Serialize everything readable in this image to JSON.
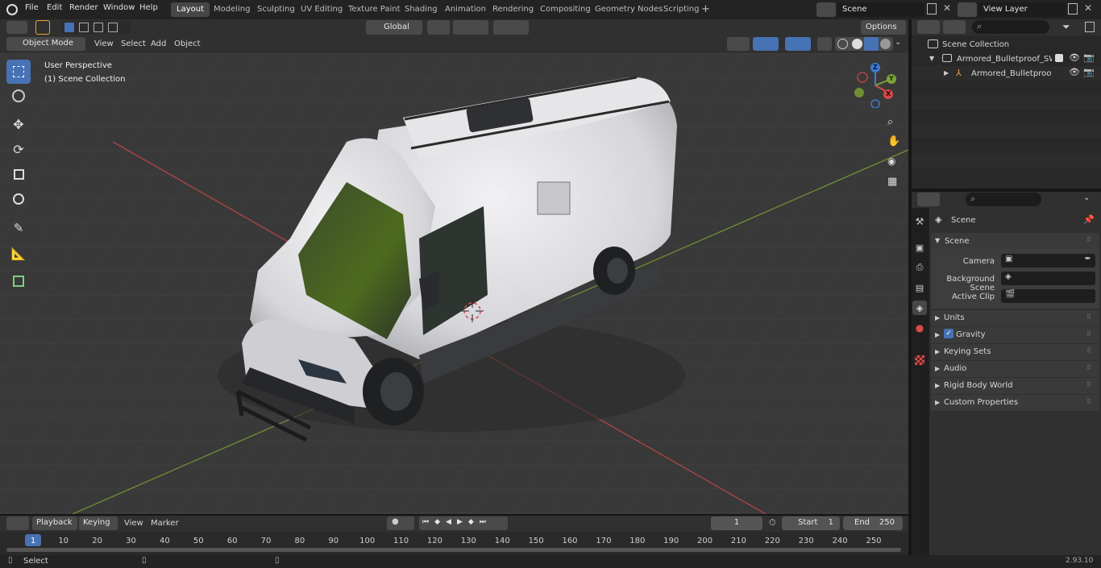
{
  "menu": [
    "File",
    "Edit",
    "Render",
    "Window",
    "Help"
  ],
  "workspaces": [
    "Layout",
    "Modeling",
    "Sculpting",
    "UV Editing",
    "Texture Paint",
    "Shading",
    "Animation",
    "Rendering",
    "Compositing",
    "Geometry Nodes",
    "Scripting"
  ],
  "active_workspace": "Layout",
  "scene_field": "Scene",
  "view_layer_field": "View Layer",
  "viewport_header": {
    "mode": "Object Mode",
    "menus": [
      "View",
      "Select",
      "Add",
      "Object"
    ],
    "transform_orientation": "Global",
    "options": "Options"
  },
  "viewport_overlay": {
    "perspective": "User Perspective",
    "collection": "(1) Scene Collection"
  },
  "gizmo": {
    "x": "X",
    "y": "Y",
    "z": "Z"
  },
  "outliner": {
    "root": "Scene Collection",
    "items": [
      "Armored_Bulletproof_SWAT_V",
      "Armored_Bulletproof_SW"
    ]
  },
  "properties": {
    "context": "Scene",
    "section": "Scene",
    "camera_label": "Camera",
    "background_label": "Background Scene",
    "clip_label": "Active Clip",
    "panels": [
      "Units",
      "Gravity",
      "Keying Sets",
      "Audio",
      "Rigid Body World",
      "Custom Properties"
    ],
    "gravity_checked": true
  },
  "timeline": {
    "menus": [
      "Playback",
      "Keying",
      "View",
      "Marker"
    ],
    "current_frame": "1",
    "start_label": "Start",
    "start_value": "1",
    "end_label": "End",
    "end_value": "250",
    "ticks": [
      "1",
      "10",
      "20",
      "30",
      "40",
      "50",
      "60",
      "70",
      "80",
      "90",
      "100",
      "110",
      "120",
      "130",
      "140",
      "150",
      "160",
      "170",
      "180",
      "190",
      "200",
      "210",
      "220",
      "230",
      "240",
      "250"
    ]
  },
  "status": {
    "left": "Select",
    "version": "2.93.10"
  },
  "colors": {
    "accent": "#4772b3",
    "x_axis": "#d64a4a",
    "y_axis": "#7fa33a",
    "z_axis": "#3f7ad1",
    "viewport_bg": "#393939"
  }
}
